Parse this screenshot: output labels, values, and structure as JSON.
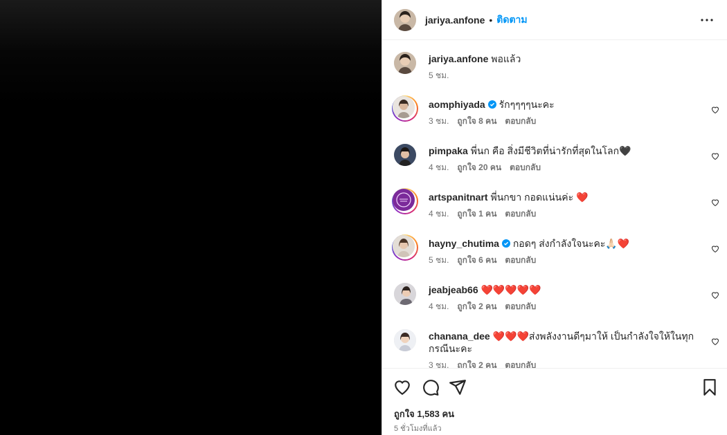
{
  "post": {
    "author": "jariya.anfone",
    "follow_label": "ติดตาม",
    "separator": "•",
    "caption": "พอแล้ว",
    "caption_time": "5 ชม."
  },
  "comments": [
    {
      "user": "aomphiyada",
      "verified": true,
      "text": "รักๆๆๆๆนะคะ",
      "time": "3 ชม.",
      "likes": "ถูกใจ 8 คน",
      "reply": "ตอบกลับ"
    },
    {
      "user": "pimpaka",
      "verified": false,
      "text": "พี่นก คือ สิ่งมีชีวิตที่น่ารักที่สุดในโลก🖤",
      "time": "4 ชม.",
      "likes": "ถูกใจ 20 คน",
      "reply": "ตอบกลับ"
    },
    {
      "user": "artspanitnart",
      "verified": false,
      "text": "พี่นกขา กอดแน่นค่ะ ❤️",
      "time": "4 ชม.",
      "likes": "ถูกใจ 1 คน",
      "reply": "ตอบกลับ"
    },
    {
      "user": "hayny_chutima",
      "verified": true,
      "text": "กอดๆ ส่งกำลังใจนะคะ🙏🏻❤️",
      "time": "5 ชม.",
      "likes": "ถูกใจ 6 คน",
      "reply": "ตอบกลับ"
    },
    {
      "user": "jeabjeab66",
      "verified": false,
      "text": "❤️❤️❤️❤️❤️",
      "time": "4 ชม.",
      "likes": "ถูกใจ 2 คน",
      "reply": "ตอบกลับ"
    },
    {
      "user": "chanana_dee",
      "verified": false,
      "text": "❤️❤️❤️ส่งพลังงานดีๆมาให้ เป็นกำลังใจให้ในทุกกรณีนะคะ",
      "time": "3 ชม.",
      "likes": "ถูกใจ 2 คน",
      "reply": "ตอบกลับ"
    }
  ],
  "footer": {
    "likes_total": "ถูกใจ 1,583 คน",
    "time_total": "5 ชั่วโมงที่แล้ว"
  },
  "icons": {
    "more": "more-options-icon",
    "like": "heart-icon",
    "comment": "comment-icon",
    "share": "share-icon",
    "save": "bookmark-icon",
    "verified": "verified-badge-icon"
  },
  "colors": {
    "accent": "#0095f6",
    "text": "#262626",
    "muted": "#737373",
    "heart": "#ed1c24"
  }
}
